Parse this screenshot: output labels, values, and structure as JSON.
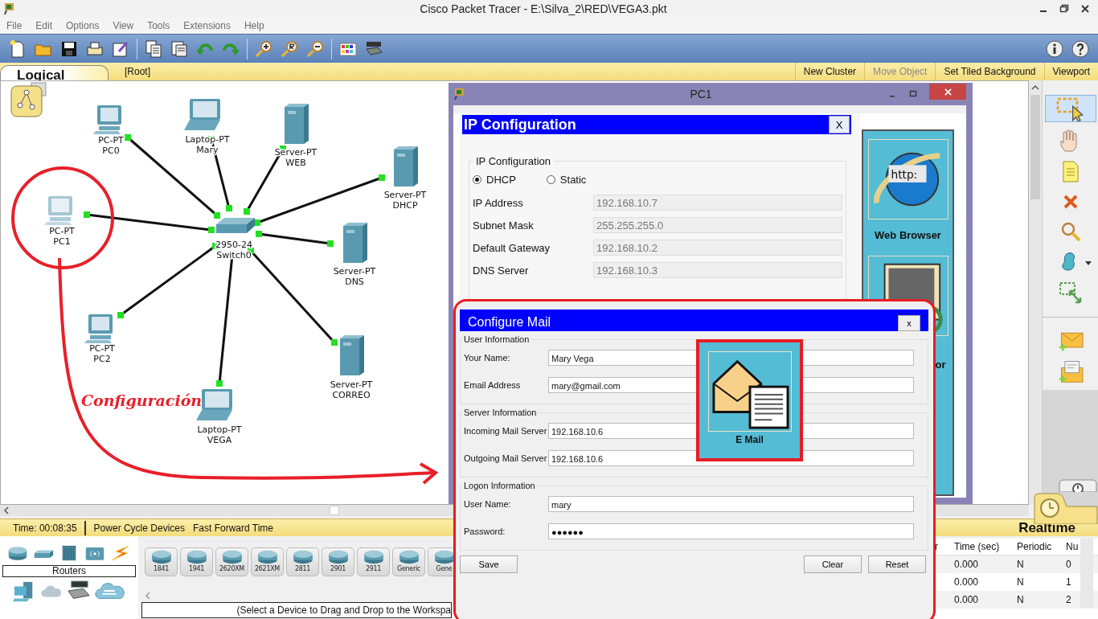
{
  "window": {
    "title": "Cisco Packet Tracer - E:\\Silva_2\\RED\\VEGA3.pkt"
  },
  "menu": [
    "File",
    "Edit",
    "Options",
    "View",
    "Tools",
    "Extensions",
    "Help"
  ],
  "workspace_bar": {
    "tab": "Logical",
    "path": "[Root]",
    "actions": [
      {
        "label": "New Cluster",
        "disabled": false
      },
      {
        "label": "Move Object",
        "disabled": true
      },
      {
        "label": "Set Tiled Background",
        "disabled": false
      },
      {
        "label": "Viewport",
        "disabled": false
      }
    ]
  },
  "network": {
    "devices": [
      {
        "kind": "pc",
        "model": "PC-PT",
        "name": "PC0",
        "link_up": true
      },
      {
        "kind": "laptop",
        "model": "Laptop-PT",
        "name": "Mary",
        "link_up": true
      },
      {
        "kind": "server",
        "model": "Server-PT",
        "name": "WEB",
        "link_up": true
      },
      {
        "kind": "server",
        "model": "Server-PT",
        "name": "DHCP",
        "link_up": true
      },
      {
        "kind": "pc",
        "model": "PC-PT",
        "name": "PC1",
        "link_up": true
      },
      {
        "kind": "switch",
        "model": "2950-24",
        "name": "Switch0"
      },
      {
        "kind": "server",
        "model": "Server-PT",
        "name": "DNS",
        "link_up": true
      },
      {
        "kind": "pc",
        "model": "PC-PT",
        "name": "PC2",
        "link_up": true
      },
      {
        "kind": "server",
        "model": "Server-PT",
        "name": "CORREO",
        "link_up": true
      },
      {
        "kind": "laptop",
        "model": "Laptop-PT",
        "name": "VEGA",
        "link_up": true
      }
    ]
  },
  "annotation": {
    "text": "Configuración"
  },
  "pc_window": {
    "title": "PC1",
    "ip_config": {
      "title": "IP Configuration",
      "close": "X",
      "group": "IP Configuration",
      "modes": [
        {
          "label": "DHCP",
          "selected": true
        },
        {
          "label": "Static",
          "selected": false
        }
      ],
      "fields": [
        {
          "label": "IP Address",
          "value": "192.168.10.7",
          "disabled": true
        },
        {
          "label": "Subnet Mask",
          "value": "255.255.255.0",
          "disabled": true
        },
        {
          "label": "Default Gateway",
          "value": "192.168.10.2",
          "disabled": true
        },
        {
          "label": "DNS Server",
          "value": "192.168.10.3",
          "disabled": true
        }
      ]
    },
    "apps": [
      {
        "kind": "browser",
        "label": "Web Browser",
        "badge": "http:"
      },
      {
        "kind": "monitor",
        "label": "or"
      }
    ]
  },
  "mail_dialog": {
    "title": "Configure Mail",
    "close": "x",
    "sections": [
      {
        "title": "User Information",
        "fields": [
          {
            "label": "Your Name:",
            "value": "Mary Vega"
          },
          {
            "label": "Email Address",
            "value": "mary@gmail.com"
          }
        ]
      },
      {
        "title": "Server Information",
        "fields": [
          {
            "label": "Incoming Mail Server",
            "value": "192.168.10.6"
          },
          {
            "label": "Outgoing Mail Server",
            "value": "192.168.10.6"
          }
        ]
      },
      {
        "title": "Logon Information",
        "fields": [
          {
            "label": "User Name:",
            "value": "mary"
          },
          {
            "label": "Password:",
            "value": "●●●●●●"
          }
        ]
      }
    ],
    "buttons": [
      "Save",
      "Clear",
      "Reset"
    ]
  },
  "email_tile": {
    "label": "E Mail"
  },
  "sim_bar": {
    "time": "Time: 00:08:35",
    "actions": [
      "Power Cycle Devices",
      "Fast Forward Time"
    ],
    "mode": "Realtime"
  },
  "device_panel": {
    "category": "Routers",
    "models": [
      "1841",
      "1941",
      "2620XM",
      "2621XM",
      "2811",
      "2901",
      "2911",
      "Generic",
      "Gene"
    ],
    "hint": "(Select a Device to Drag and Drop to the Workspa"
  },
  "event_list": {
    "columns": [
      "r",
      "Time (sec)",
      "Periodic",
      "Nu"
    ],
    "rows": [
      {
        "time": "0.000",
        "periodic": "N",
        "num": "0"
      },
      {
        "time": "0.000",
        "periodic": "N",
        "num": "1"
      },
      {
        "time": "0.000",
        "periodic": "N",
        "num": "2"
      }
    ]
  }
}
